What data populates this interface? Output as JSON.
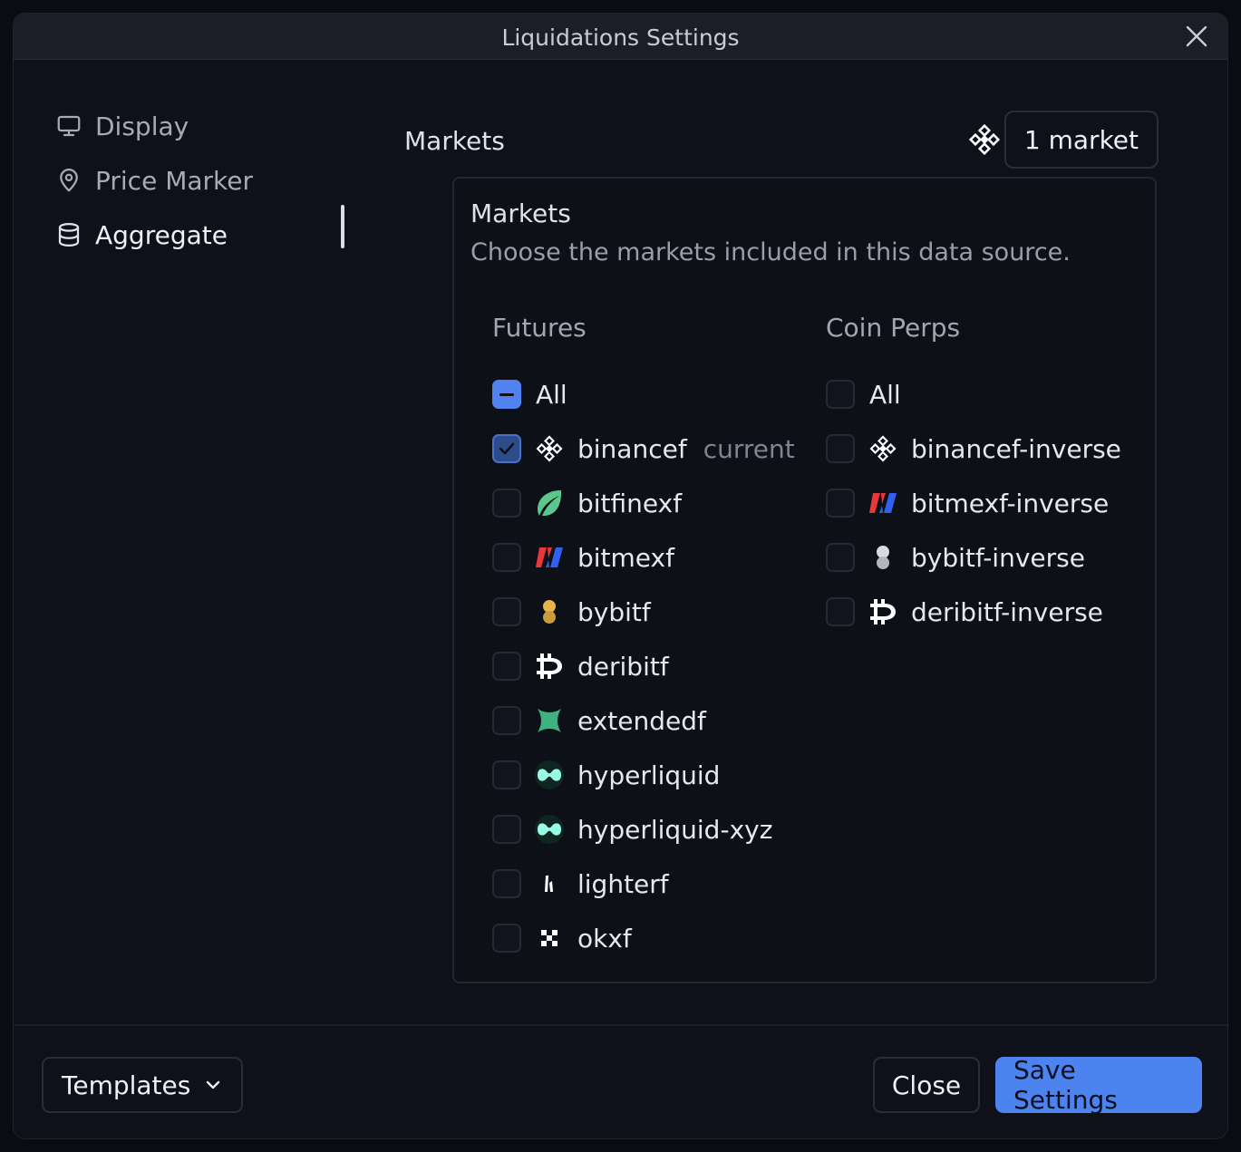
{
  "dialog": {
    "title": "Liquidations Settings",
    "close_icon": "close-icon"
  },
  "sidebar": {
    "items": [
      {
        "label": "Display",
        "icon": "monitor-icon",
        "active": false
      },
      {
        "label": "Price Marker",
        "icon": "map-pin-icon",
        "active": false
      },
      {
        "label": "Aggregate",
        "icon": "database-icon",
        "active": true
      }
    ]
  },
  "markets": {
    "label": "Markets",
    "count_label": "1 market",
    "header_icon": "binance-icon",
    "panel_title": "Markets",
    "panel_description": "Choose the markets included in this data source.",
    "futures": {
      "heading": "Futures",
      "all_label": "All",
      "all_state": "indeterminate",
      "items": [
        {
          "name": "binancef",
          "icon": "binance-icon",
          "checked": true,
          "note": "current"
        },
        {
          "name": "bitfinexf",
          "icon": "bitfinex-icon",
          "checked": false
        },
        {
          "name": "bitmexf",
          "icon": "bitmex-icon",
          "checked": false
        },
        {
          "name": "bybitf",
          "icon": "bybit-icon",
          "checked": false
        },
        {
          "name": "deribitf",
          "icon": "deribit-icon",
          "checked": false
        },
        {
          "name": "extendedf",
          "icon": "extended-icon",
          "checked": false
        },
        {
          "name": "hyperliquid",
          "icon": "hyperliquid-icon",
          "checked": false
        },
        {
          "name": "hyperliquid-xyz",
          "icon": "hyperliquid-icon",
          "checked": false
        },
        {
          "name": "lighterf",
          "icon": "lighter-icon",
          "checked": false
        },
        {
          "name": "okxf",
          "icon": "okx-icon",
          "checked": false
        }
      ]
    },
    "coin_perps": {
      "heading": "Coin Perps",
      "all_label": "All",
      "all_state": "unchecked",
      "items": [
        {
          "name": "binancef-inverse",
          "icon": "binance-icon",
          "checked": false
        },
        {
          "name": "bitmexf-inverse",
          "icon": "bitmex-icon",
          "checked": false
        },
        {
          "name": "bybitf-inverse",
          "icon": "bybit-icon",
          "checked": false
        },
        {
          "name": "deribitf-inverse",
          "icon": "deribit-icon",
          "checked": false
        }
      ]
    }
  },
  "footer": {
    "templates_label": "Templates",
    "close_label": "Close",
    "save_label": "Save Settings"
  },
  "colors": {
    "accent": "#4c83ee",
    "background": "#0e1119",
    "titlebar": "#1b1e26"
  }
}
